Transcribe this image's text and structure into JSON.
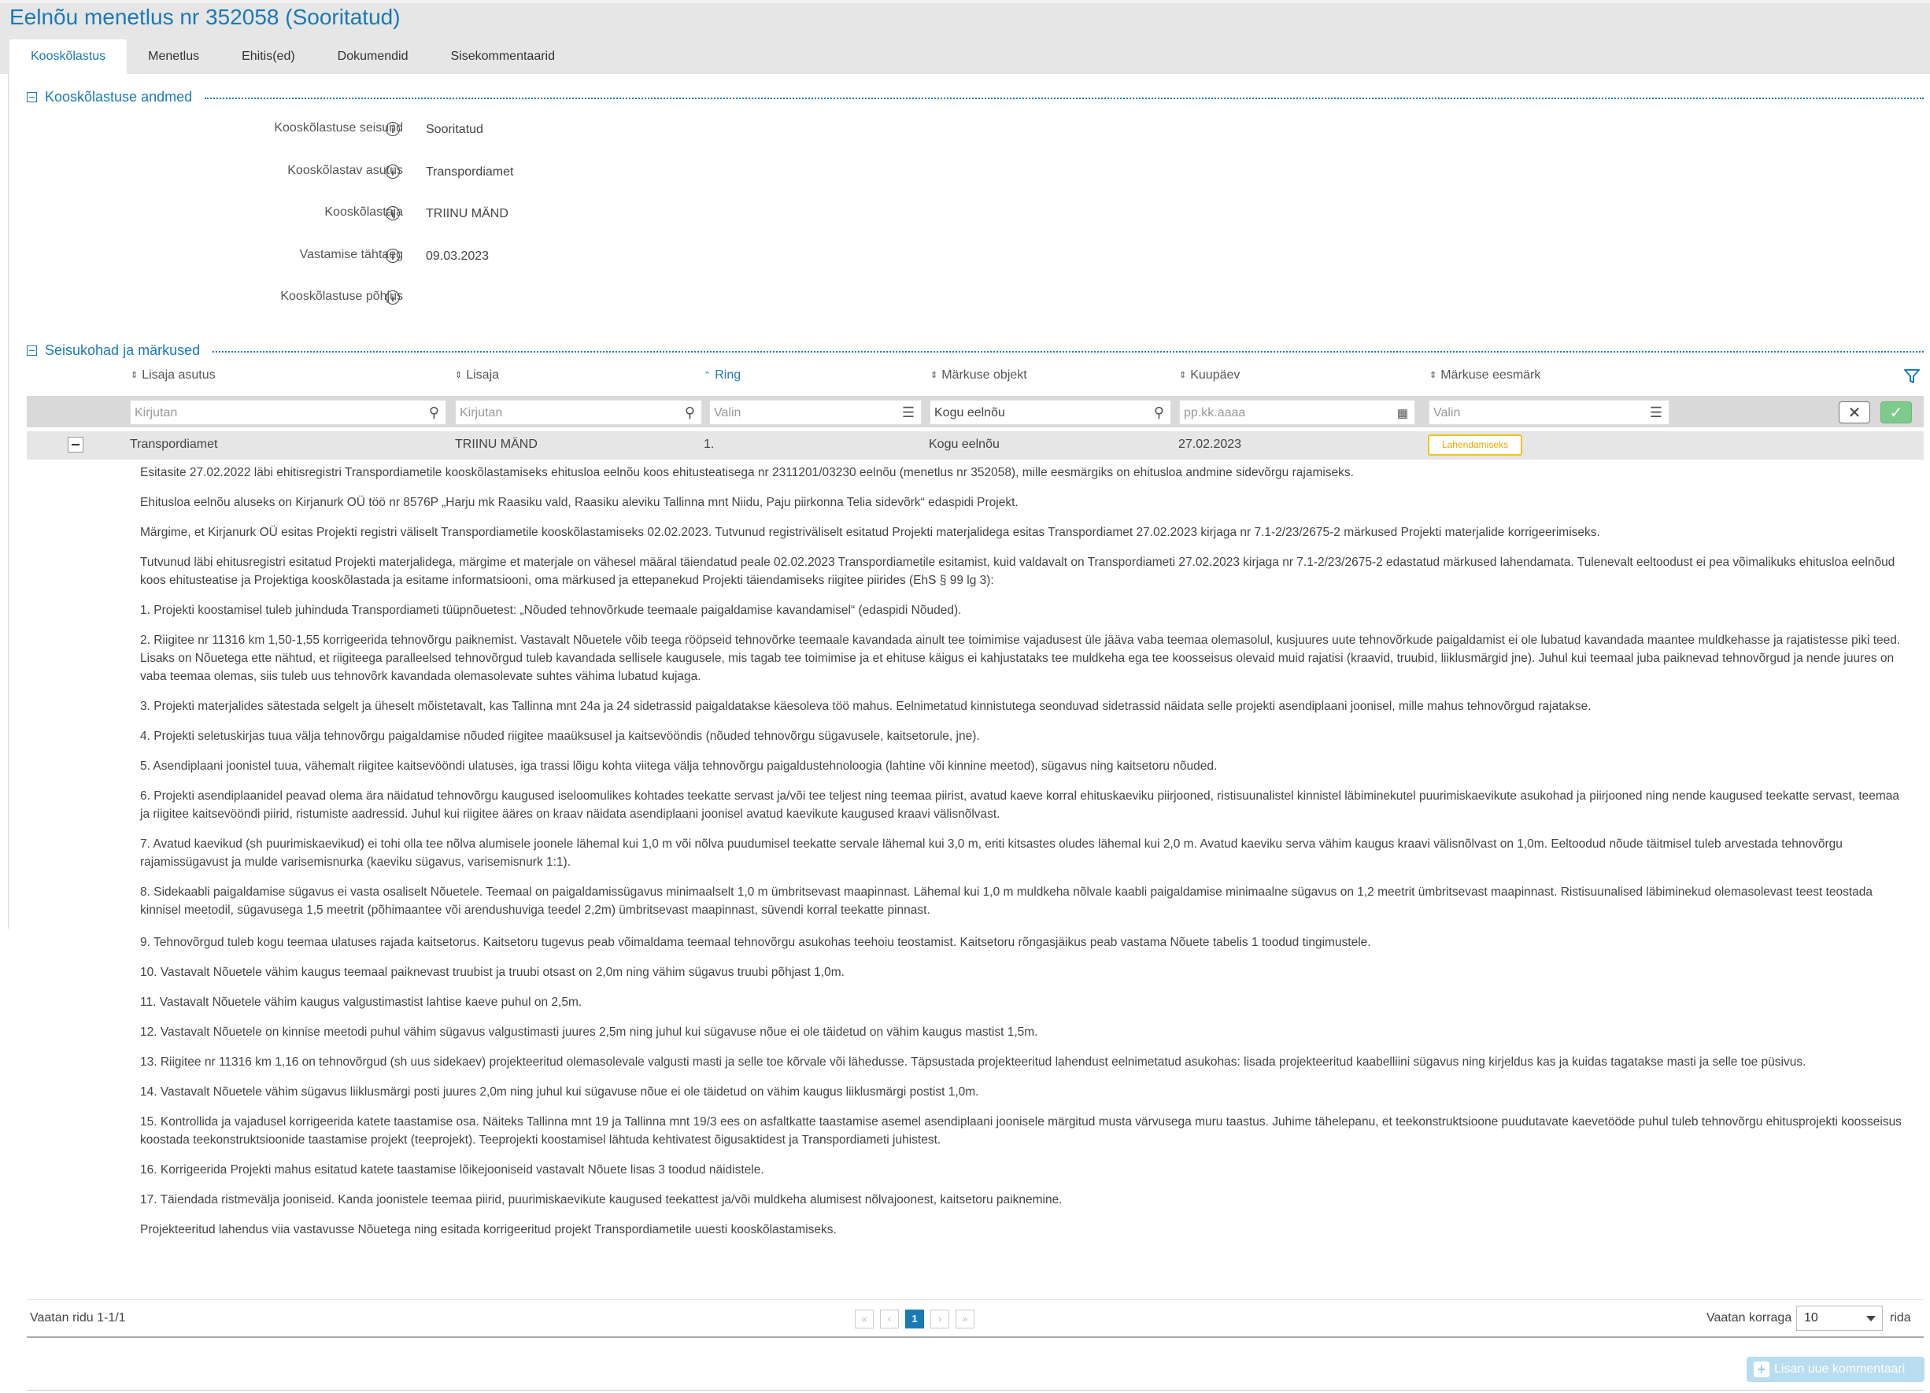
{
  "page_title": "Eelnõu menetlus nr 352058 (Sooritatud)",
  "tabs": [
    {
      "label": "Kooskõlastus",
      "active": true
    },
    {
      "label": "Menetlus",
      "active": false
    },
    {
      "label": "Ehitis(ed)",
      "active": false
    },
    {
      "label": "Dokumendid",
      "active": false
    },
    {
      "label": "Sisekommentaarid",
      "active": false
    }
  ],
  "section1": {
    "title": "Kooskõlastuse andmed",
    "fields": [
      {
        "label": "Kooskõlastuse seisund",
        "value": "Sooritatud"
      },
      {
        "label": "Kooskõlastav asutus",
        "value": "Transpordiamet"
      },
      {
        "label": "Kooskõlastaja",
        "value": "TRIINU MÄND"
      },
      {
        "label": "Vastamise tähtaeg",
        "value": "09.03.2023"
      },
      {
        "label": "Kooskõlastuse põhjus",
        "value": ""
      }
    ]
  },
  "section2": {
    "title": "Seisukohad ja märkused",
    "columns": [
      "Lisaja asutus",
      "Lisaja",
      "Ring",
      "Märkuse objekt",
      "Kuupäev",
      "Märkuse eesmärk"
    ],
    "filters": {
      "asutus_placeholder": "Kirjutan",
      "lisaja_placeholder": "Kirjutan",
      "ring_placeholder": "Valin",
      "objekt_value": "Kogu eelnõu",
      "kuupaev_placeholder": "pp.kk.aaaa",
      "eesmark_placeholder": "Valin"
    },
    "row": {
      "asutus": "Transpordiamet",
      "lisaja": "TRIINU MÄND",
      "ring": "1.",
      "objekt": "Kogu eelnõu",
      "kuupaev": "27.02.2023",
      "eesmark": "Lahendamiseks"
    },
    "comment_paragraphs": [
      "Esitasite 27.02.2022 läbi ehitisregistri Transpordiametile kooskõlastamiseks ehitusloa eelnõu koos ehitusteatisega nr 2311201/03230 eelnõu (menetlus nr 352058), mille eesmärgiks on ehitusloa andmine sidevõrgu rajamiseks.",
      "Ehitusloa eelnõu aluseks on Kirjanurk OÜ töö nr 8576P „Harju mk Raasiku vald, Raasiku aleviku Tallinna mnt Niidu, Paju piirkonna Telia sidevõrk“ edaspidi Projekt.",
      "Märgime, et Kirjanurk OÜ esitas Projekti registri väliselt Transpordiametile kooskõlastamiseks 02.02.2023. Tutvunud registriväliselt esitatud Projekti materjalidega esitas Transpordiamet 27.02.2023 kirjaga nr 7.1-2/23/2675-2 märkused Projekti materjalide korrigeerimiseks.",
      "Tutvunud läbi ehitusregistri esitatud Projekti materjalidega, märgime et materjale on vähesel määral täiendatud peale 02.02.2023 Transpordiametile esitamist, kuid valdavalt on Transpordiameti 27.02.2023 kirjaga nr 7.1-2/23/2675-2 edastatud märkused lahendamata. Tulenevalt eeltoodust ei pea võimalikuks ehitusloa eelnõud koos ehitusteatise ja Projektiga kooskõlastada ja esitame informatsiooni, oma märkused ja ettepanekud Projekti täiendamiseks riigitee piirides (EhS § 99 lg 3):",
      "1. Projekti koostamisel tuleb juhinduda Transpordiameti tüüpnõuetest: „Nõuded tehnovõrkude teemaale paigaldamise kavandamisel“ (edaspidi Nõuded).",
      "2. Riigitee nr 11316 km 1,50-1,55 korrigeerida tehnovõrgu paiknemist. Vastavalt Nõuetele võib teega rööpseid tehnovõrke teemaale kavandada ainult tee toimimise vajadusest üle jääva vaba teemaa olemasolul, kusjuures uute tehnovõrkude paigaldamist ei ole lubatud kavandada maantee muldkehasse ja rajatistesse piki teed. Lisaks on Nõuetega ette nähtud, et riigiteega paralleelsed tehnovõrgud tuleb kavandada sellisele kaugusele, mis tagab tee toimimise ja et ehituse käigus ei kahjustataks tee muldkeha ega tee koosseisus olevaid muid rajatisi (kraavid, truubid, liiklusmärgid jne). Juhul kui teemaal juba paiknevad tehnovõrgud ja nende juures on vaba teemaa olemas, siis tuleb uus tehnovõrk kavandada olemasolevate suhtes vähima lubatud kujaga.",
      "3. Projekti materjalides sätestada selgelt ja üheselt mõistetavalt, kas Tallinna mnt 24a ja 24 sidetrassid paigaldatakse käesoleva töö mahus. Eelnimetatud kinnistutega seonduvad sidetrassid näidata selle projekti asendiplaani joonisel, mille mahus tehnovõrgud rajatakse.",
      "4. Projekti seletuskirjas tuua välja tehnovõrgu paigaldamise nõuded riigitee maaüksusel ja kaitsevööndis (nõuded tehnovõrgu sügavusele, kaitsetorule, jne).",
      "5. Asendiplaani joonistel tuua, vähemalt riigitee kaitsevööndi ulatuses, iga trassi lõigu kohta viitega välja tehnovõrgu paigaldustehnoloogia (lahtine või kinnine meetod), sügavus ning kaitsetoru nõuded.",
      "6. Projekti asendiplaanidel peavad olema ära näidatud tehnovõrgu kaugused iseloomulikes kohtades teekatte servast ja/või tee teljest ning teemaa piirist, avatud kaeve korral ehituskaeviku piirjooned, ristisuunalistel kinnistel läbiminekutel puurimiskaevikute asukohad ja piirjooned ning nende kaugused teekatte servast, teemaa ja riigitee kaitsevööndi piirid, ristumiste aadressid. Juhul kui riigitee ääres on kraav näidata asendiplaani joonisel avatud kaevikute kaugused kraavi välisnõlvast.",
      "7. Avatud kaevikud (sh puurimiskaevikud) ei tohi olla tee nõlva alumisele joonele lähemal kui 1,0 m või nõlva puudumisel teekatte servale lähemal kui 3,0 m, eriti kitsastes oludes lähemal kui 2,0 m. Avatud kaeviku serva vähim kaugus kraavi välisnõlvast on 1,0m. Eeltoodud nõude täitmisel tuleb arvestada tehnovõrgu rajamissügavust ja mulde varisemisnurka (kaeviku sügavus, varisemisnurk 1:1).",
      "8. Sidekaabli paigaldamise sügavus ei vasta osaliselt Nõuetele. Teemaal on paigaldamissügavus minimaalselt 1,0 m ümbritsevast maapinnast. Lähemal kui 1,0 m muldkeha nõlvale kaabli paigaldamise minimaalne sügavus on 1,2 meetrit ümbritsevast maapinnast. Ristisuunalised läbiminekud olemasolevast teest teostada kinnisel meetodil, sügavusega 1,5 meetrit (põhimaantee või arendushuviga teedel 2,2m) ümbritsevast maapinnast, süvendi korral teekatte pinnast.",
      "9. Tehnovõrgud tuleb kogu teemaa ulatuses rajada kaitsetorus. Kaitsetoru tugevus peab võimaldama teemaal tehnovõrgu asukohas teehoiu teostamist. Kaitsetoru rõngasjäikus peab vastama Nõuete tabelis 1 toodud tingimustele.",
      "10.  Vastavalt Nõuetele vähim kaugus teemaal paiknevast truubist ja truubi otsast on 2,0m ning vähim sügavus truubi põhjast 1,0m.",
      "11.  Vastavalt Nõuetele vähim kaugus valgustimastist lahtise kaeve puhul on 2,5m.",
      "12.  Vastavalt Nõuetele on kinnise meetodi puhul vähim sügavus valgustimasti juures 2,5m ning juhul kui sügavuse nõue ei ole täidetud on vähim kaugus mastist 1,5m.",
      "13.  Riigitee nr 11316 km 1,16 on tehnovõrgud (sh uus sidekaev) projekteeritud olemasolevale valgusti masti ja selle toe kõrvale või lähedusse. Täpsustada projekteeritud lahendust eelnimetatud asukohas: lisada projekteeritud kaabelliini sügavus ning kirjeldus kas ja kuidas tagatakse masti ja selle toe püsivus.",
      "14.  Vastavalt Nõuetele vähim sügavus liiklusmärgi posti juures 2,0m ning juhul kui sügavuse nõue ei ole täidetud on vähim kaugus liiklusmärgi postist 1,0m.",
      "15.  Kontrollida ja vajadusel korrigeerida katete taastamise osa. Näiteks Tallinna mnt 19 ja Tallinna mnt 19/3 ees on asfaltkatte taastamise asemel asendiplaani joonisele märgitud musta värvusega muru taastus. Juhime tähelepanu, et teekonstruktsioone puudutavate kaevetööde puhul tuleb tehnovõrgu ehitusprojekti koosseisus koostada teekonstruktsioonide taastamise projekt (teeprojekt). Teeprojekti koostamisel lähtuda kehtivatest õigusaktidest ja Transpordiameti juhistest.",
      "16.  Korrigeerida Projekti mahus esitatud katete taastamise lõikejooniseid vastavalt Nõuete lisas 3 toodud näidistele.",
      "17.  Täiendada ristmevälja jooniseid. Kanda joonistele teemaa piirid, puurimiskaevikute kaugused teekattest ja/või muldkeha alumisest nõlvajoonest, kaitsetoru paiknemine.",
      "Projekteeritud lahendus viia vastavusse Nõuetega ning esitada korrigeeritud projekt Transpordiametile uuesti kooskõlastamiseks."
    ],
    "pagination": {
      "rows_text": "Vaatan ridu 1-1/1",
      "current_page": "1",
      "first": "«",
      "prev": "‹",
      "next": "›",
      "last": "»",
      "per_page_label": "Vaatan korraga",
      "per_page_value": "10",
      "per_page_suffix": "rida"
    },
    "add_button": "Lisan uue kommentaari"
  },
  "icons": {
    "info": "info-circle-icon",
    "search": "search-icon",
    "list": "list-icon",
    "calendar": "calendar-icon",
    "filter": "filter-icon",
    "sort": "sort-arrows-icon"
  },
  "colors": {
    "accent": "#1a7ab5",
    "badge_border": "#f0c419",
    "apply_button": "#7ec98c"
  }
}
